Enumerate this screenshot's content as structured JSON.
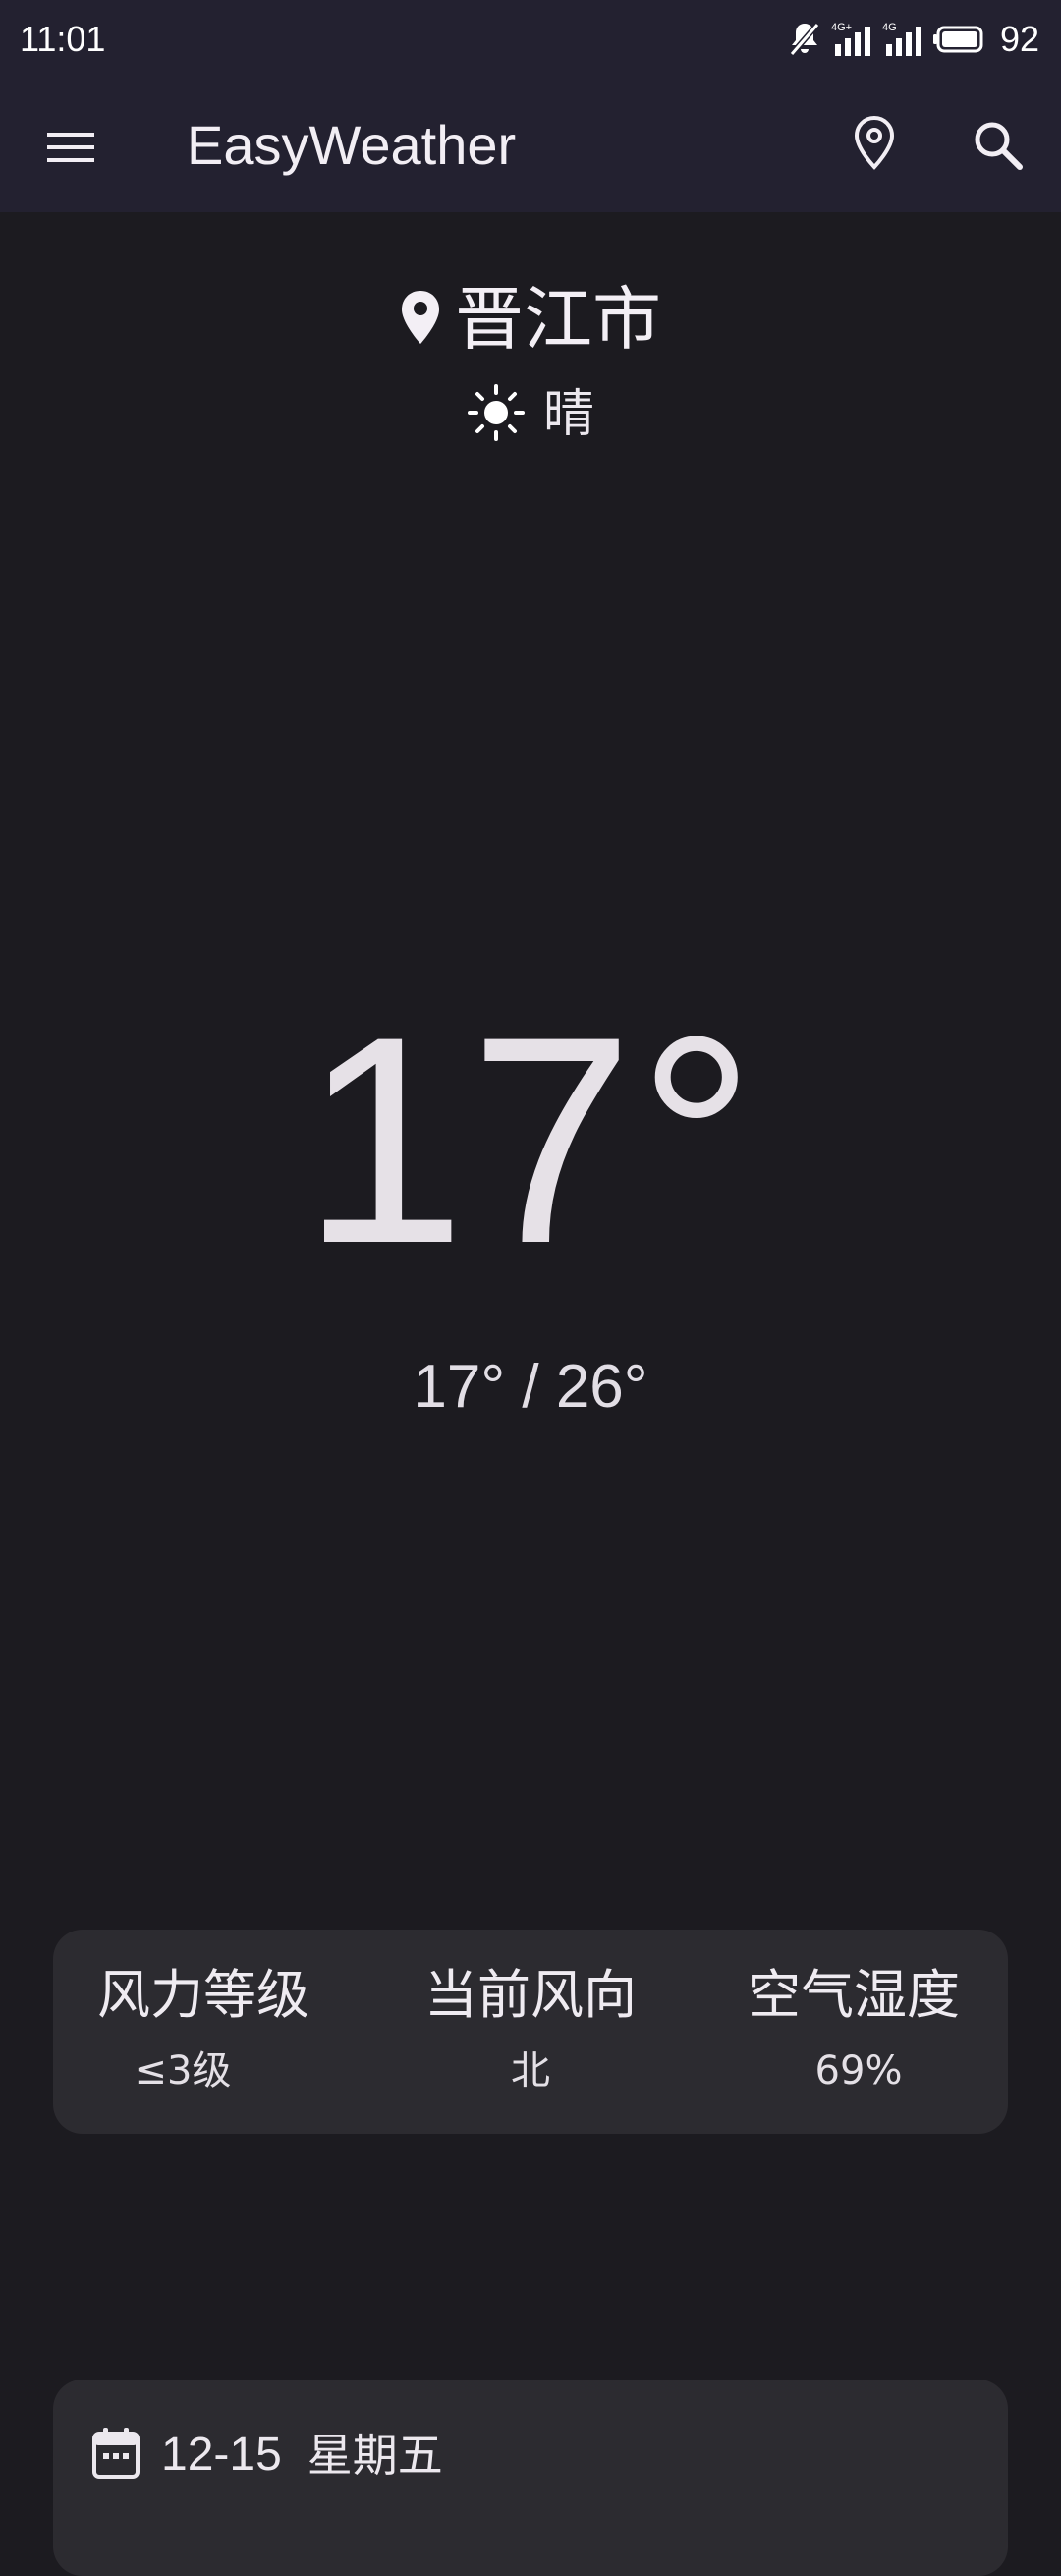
{
  "status_bar": {
    "time": "11:01",
    "network_1": "4G+",
    "network_2": "4G",
    "battery": "92",
    "icons": [
      "notifications-off-icon",
      "signal-icon",
      "signal-icon",
      "battery-icon"
    ]
  },
  "app_bar": {
    "title": "EasyWeather",
    "menu_icon": "menu-icon",
    "location_icon": "location-pin-icon",
    "search_icon": "search-icon"
  },
  "current": {
    "city": "晋江市",
    "condition": "晴",
    "condition_icon": "sun-icon",
    "temperature": "17°",
    "range": "17° / 26°"
  },
  "details": [
    {
      "label": "风力等级",
      "value": "≤3级"
    },
    {
      "label": "当前风向",
      "value": "北"
    },
    {
      "label": "空气湿度",
      "value": "69%"
    }
  ],
  "forecast": {
    "date": "12-15",
    "weekday": "星期五",
    "icon": "calendar-icon"
  },
  "colors": {
    "background": "#1c1b20",
    "bar": "#232130",
    "card": "#2c2b30",
    "text": "#e8e4ea"
  }
}
